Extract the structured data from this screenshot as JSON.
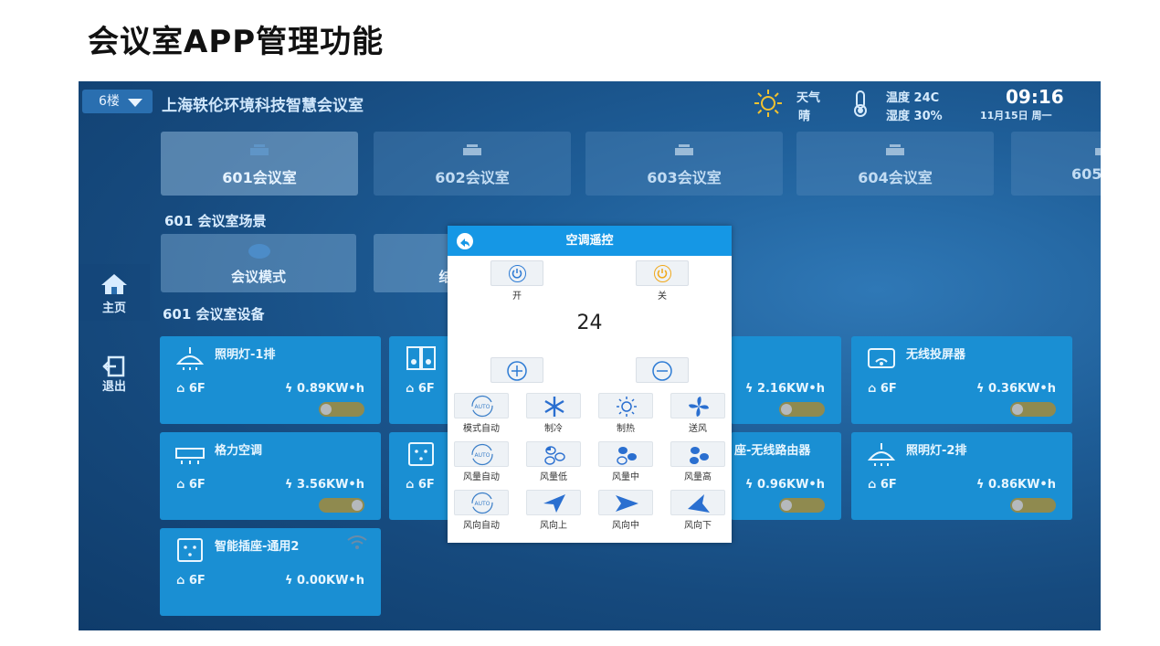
{
  "slide": {
    "title": "会议室APP管理功能"
  },
  "app": {
    "floor_select": "6楼",
    "venue": "上海轶伦环境科技智慧会议室",
    "weather": {
      "label": "天气",
      "value": "晴"
    },
    "climate": {
      "temperature": "温度 24C",
      "humidity": "湿度 30%"
    },
    "clock": {
      "time": "09:16",
      "date": "11月15日  周一"
    }
  },
  "sidebar": {
    "items": [
      {
        "label": "主页",
        "icon": "home-icon"
      },
      {
        "label": "退出",
        "icon": "logout-icon"
      }
    ]
  },
  "rooms": [
    {
      "label": "601会议室",
      "active": true
    },
    {
      "label": "602会议室",
      "active": false
    },
    {
      "label": "603会议室",
      "active": false
    },
    {
      "label": "604会议室",
      "active": false
    },
    {
      "label": "605",
      "active": false
    }
  ],
  "scenes": {
    "title": "601 会议室场景",
    "items": [
      {
        "label": "会议模式"
      },
      {
        "label": "结"
      }
    ]
  },
  "devices": {
    "title": "601 会议室设备",
    "items": [
      {
        "name": "照明灯-1排",
        "floor": "6F",
        "kwh": "0.89KW•h",
        "icon": "ceiling-lamp-icon"
      },
      {
        "name": "",
        "floor": "6F",
        "kwh": "",
        "icon": "speaker-icon"
      },
      {
        "name": "",
        "floor": "",
        "kwh": "2.16KW•h",
        "icon": ""
      },
      {
        "name": "无线投屏器",
        "floor": "6F",
        "kwh": "0.36KW•h",
        "icon": "cast-icon"
      },
      {
        "name": "格力空调",
        "floor": "6F",
        "kwh": "3.56KW•h",
        "icon": "air-conditioner-icon"
      },
      {
        "name": "",
        "floor": "6F",
        "kwh": "",
        "icon": "socket-icon"
      },
      {
        "name": "座-无线路由器",
        "floor": "",
        "kwh": "0.96KW•h",
        "icon": ""
      },
      {
        "name": "照明灯-2排",
        "floor": "6F",
        "kwh": "0.86KW•h",
        "icon": "ceiling-lamp-icon"
      },
      {
        "name": "智能插座-通用2",
        "floor": "6F",
        "kwh": "0.00KW•h",
        "icon": "socket-icon"
      }
    ]
  },
  "remote": {
    "title": "空调遥控",
    "power_on": "开",
    "power_off": "关",
    "temperature": "24",
    "grid": [
      {
        "label": "模式自动",
        "icon": "auto-icon"
      },
      {
        "label": "制冷",
        "icon": "snowflake-icon"
      },
      {
        "label": "制热",
        "icon": "sun-icon"
      },
      {
        "label": "送风",
        "icon": "fan-icon"
      },
      {
        "label": "风量自动",
        "icon": "auto-icon"
      },
      {
        "label": "风量低",
        "icon": "fan-low-icon"
      },
      {
        "label": "风量中",
        "icon": "fan-mid-icon"
      },
      {
        "label": "风量高",
        "icon": "fan-high-icon"
      },
      {
        "label": "风向自动",
        "icon": "auto-icon"
      },
      {
        "label": "风向上",
        "icon": "arrow-up-icon"
      },
      {
        "label": "风向中",
        "icon": "arrow-right-icon"
      },
      {
        "label": "风向下",
        "icon": "arrow-down-icon"
      }
    ]
  },
  "colors": {
    "card": "#1a8fd3",
    "modal_header": "#1597e5",
    "accent_blue": "#2d7bd4",
    "accent_orange": "#f0a81a"
  }
}
